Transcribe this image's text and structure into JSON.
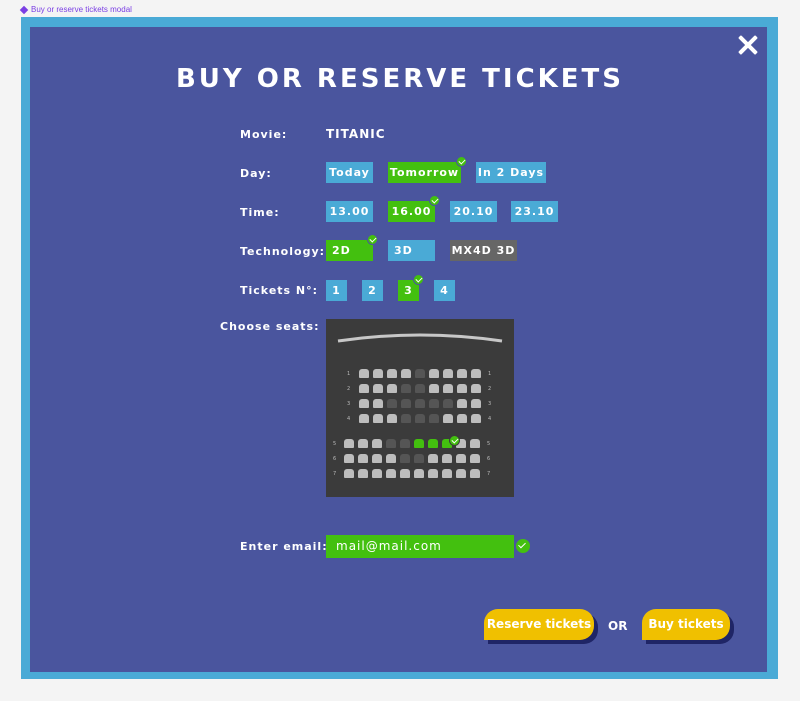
{
  "frame": {
    "label": "Buy or reserve tickets modal"
  },
  "modal": {
    "title": "BUY OR RESERVE TICKETS",
    "close_icon": "close-icon"
  },
  "movie": {
    "label": "Movie:",
    "value": "TITANIC"
  },
  "day": {
    "label": "Day:",
    "options": [
      "Today",
      "Tomorrow",
      "In 2 Days"
    ],
    "selected": "Tomorrow"
  },
  "time": {
    "label": "Time:",
    "options": [
      "13.00",
      "16.00",
      "20.10",
      "23.10"
    ],
    "selected": "16.00"
  },
  "technology": {
    "label": "Technology:",
    "options": [
      "2D",
      "3D",
      "MX4D 3D"
    ],
    "selected": "2D",
    "unavailable": "MX4D 3D"
  },
  "tickets": {
    "label": "Tickets N°:",
    "options": [
      "1",
      "2",
      "3",
      "4"
    ],
    "selected": "3"
  },
  "seats": {
    "label": "Choose seats:",
    "rows": [
      {
        "number": "1",
        "left": "1",
        "right": "1",
        "states": [
          "free",
          "free",
          "free",
          "free",
          "taken",
          "free",
          "free",
          "free",
          "free"
        ]
      },
      {
        "number": "2",
        "left": "2",
        "right": "2",
        "states": [
          "free",
          "free",
          "free",
          "taken",
          "taken",
          "free",
          "free",
          "free",
          "free"
        ]
      },
      {
        "number": "3",
        "left": "3",
        "right": "3",
        "states": [
          "free",
          "free",
          "taken",
          "taken",
          "taken",
          "taken",
          "taken",
          "free",
          "free"
        ]
      },
      {
        "number": "4",
        "left": "4",
        "right": "4",
        "states": [
          "free",
          "free",
          "free",
          "taken",
          "taken",
          "taken",
          "free",
          "free",
          "free"
        ]
      },
      {
        "number": "5",
        "left": "5",
        "right": "5",
        "states": [
          "free",
          "free",
          "free",
          "taken",
          "taken",
          "selected",
          "selected",
          "selected",
          "free",
          "free"
        ]
      },
      {
        "number": "6",
        "left": "6",
        "right": "6",
        "states": [
          "free",
          "free",
          "free",
          "free",
          "taken",
          "taken",
          "free",
          "free",
          "free",
          "free"
        ]
      },
      {
        "number": "7",
        "left": "7",
        "right": "7",
        "states": [
          "free",
          "free",
          "free",
          "free",
          "free",
          "free",
          "free",
          "free",
          "free",
          "free"
        ]
      }
    ],
    "colors": {
      "free": "#bdbdbd",
      "taken": "#555555",
      "selected": "#43c00f"
    }
  },
  "email": {
    "label": "Enter email:",
    "value": "mail@mail.com",
    "valid": true
  },
  "actions": {
    "reserve_label": "Reserve tickets",
    "or_label": "OR",
    "buy_label": "Buy tickets"
  },
  "colors": {
    "modal_bg": "#4a559e",
    "border": "#4aaad6",
    "selected": "#43c00f",
    "cta": "#f0c000"
  }
}
